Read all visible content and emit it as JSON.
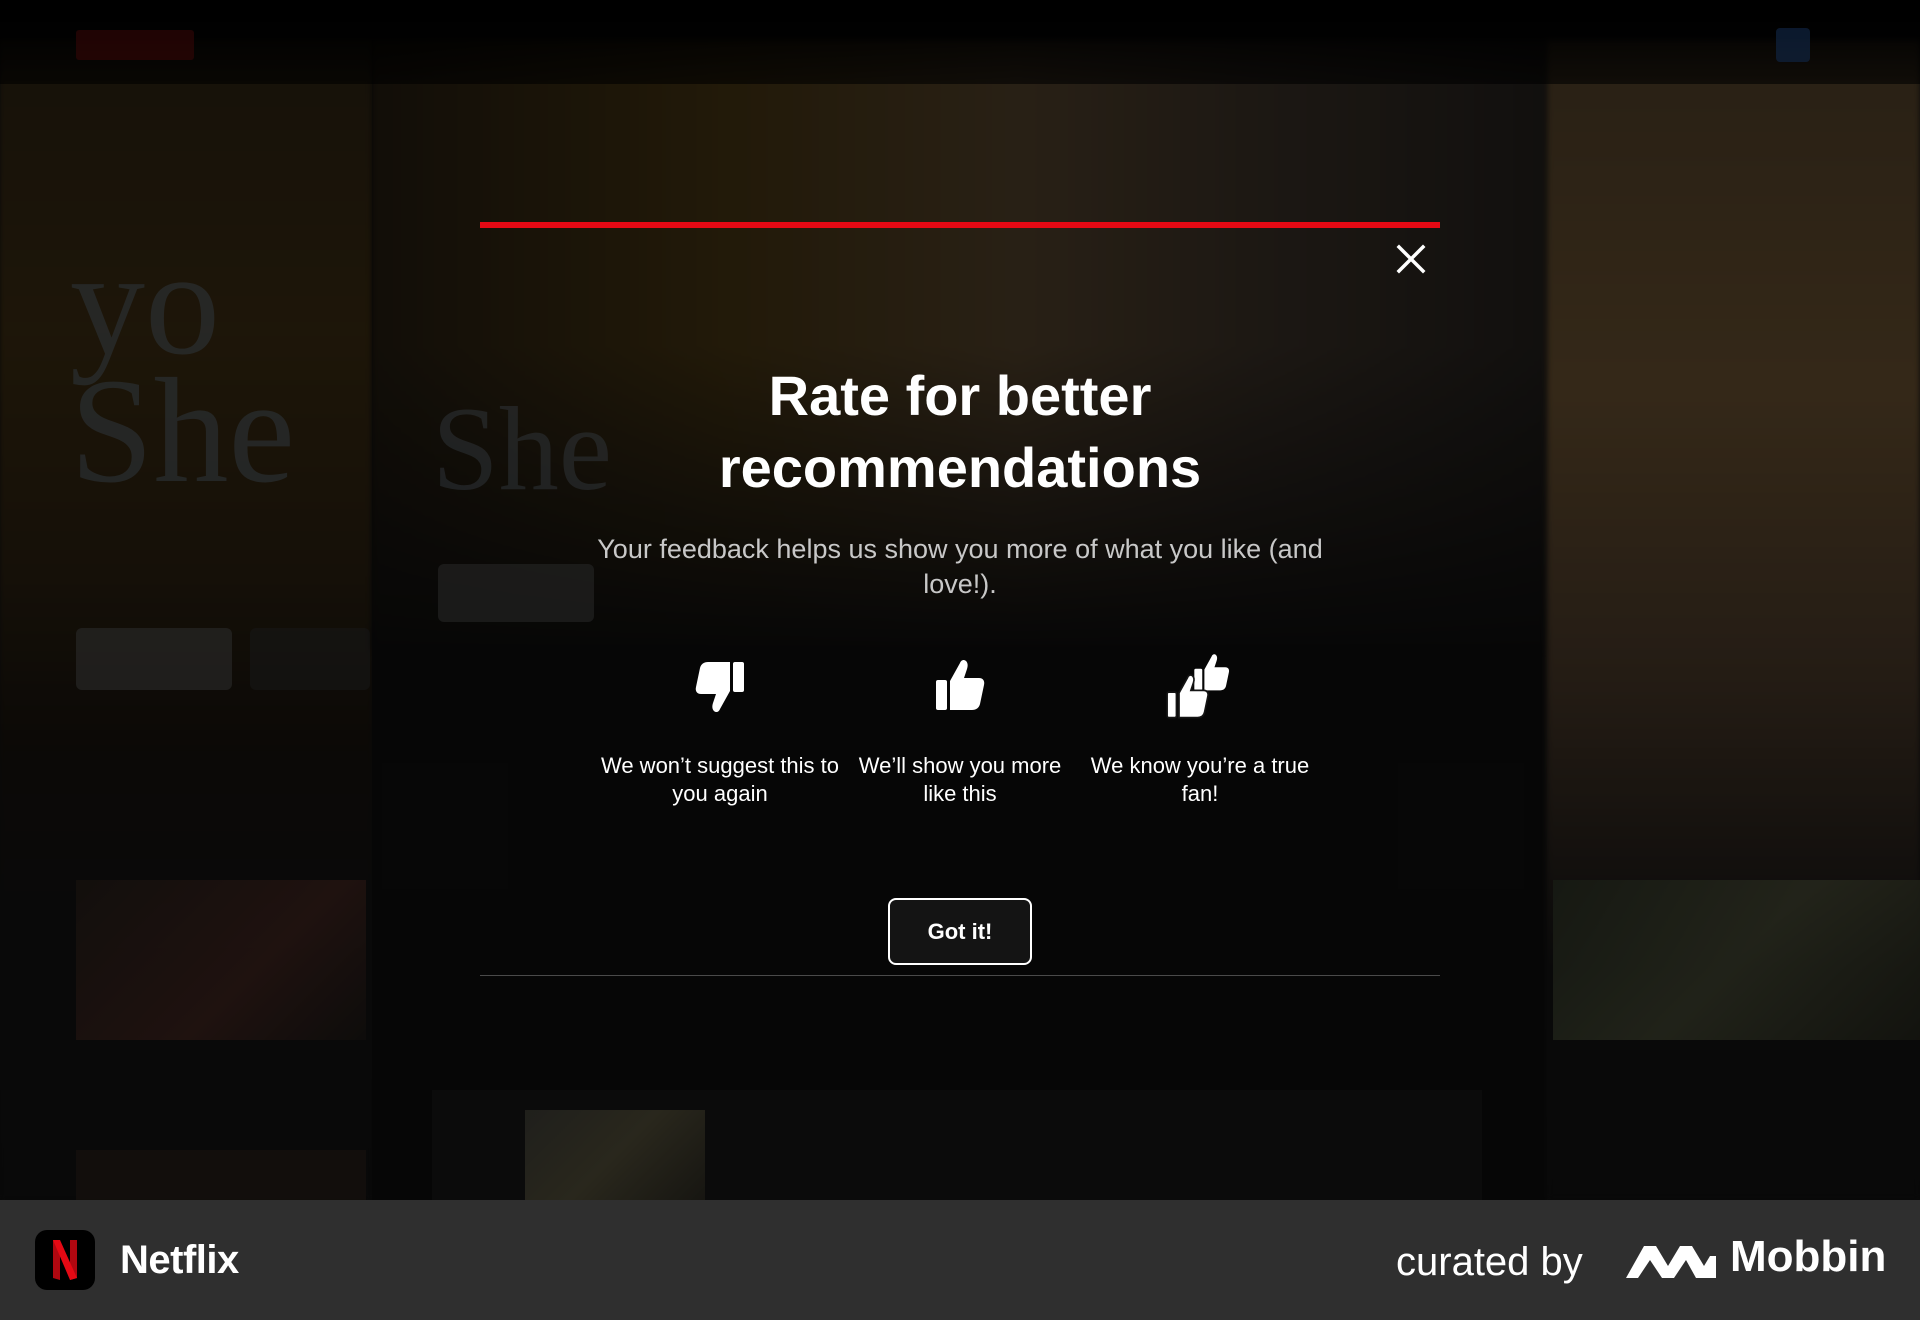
{
  "modal": {
    "title": "Rate for better recommendations",
    "subtitle": "Your feedback helps us show you more of what you like (and love!).",
    "options": [
      {
        "icon": "thumbs-down-icon",
        "label": "We won’t suggest this to you again"
      },
      {
        "icon": "thumbs-up-icon",
        "label": "We’ll show you more like this"
      },
      {
        "icon": "double-thumbs-up-icon",
        "label": "We know you’re a true fan!"
      }
    ],
    "confirm_label": "Got it!",
    "close_icon": "close-icon",
    "accent_color": "#e50914"
  },
  "footer": {
    "app_name": "Netflix",
    "curated_by": "curated by",
    "brand": "Mobbin"
  }
}
